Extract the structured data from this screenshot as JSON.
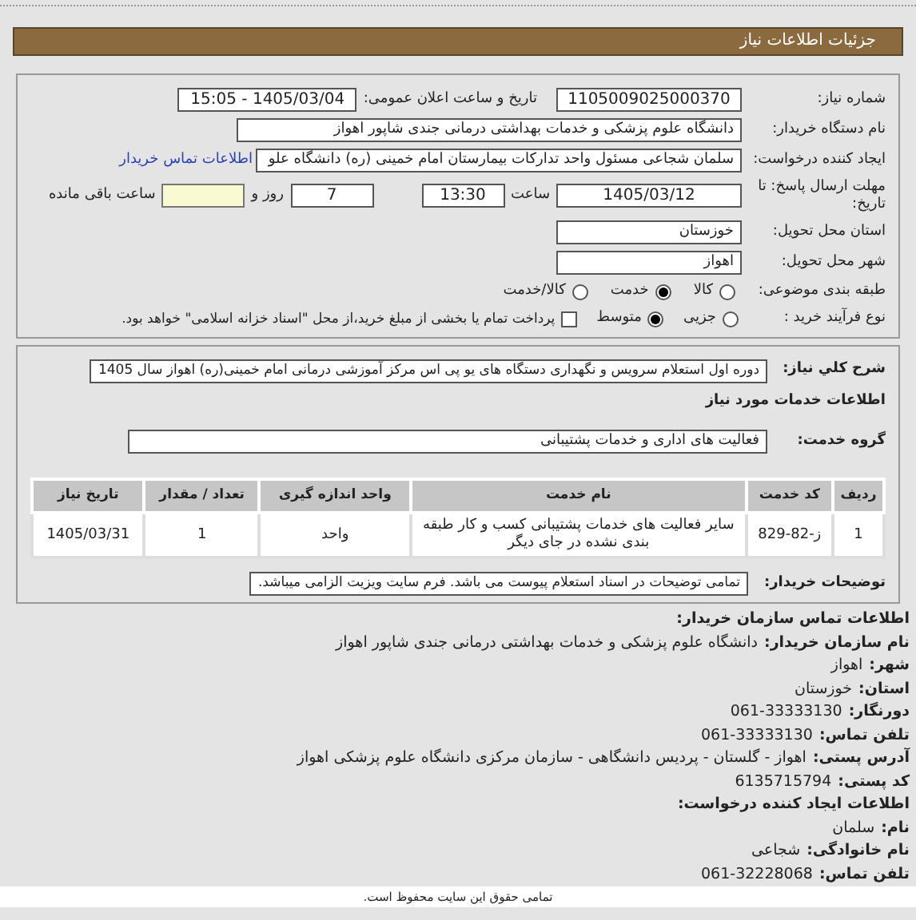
{
  "header": {
    "title": "جزئیات اطلاعات نیاز"
  },
  "need_number": {
    "label": "شماره نیاز:",
    "value": "1105009025000370"
  },
  "announce": {
    "label": "تاریخ و ساعت اعلان عمومی:",
    "value": "1405/03/04 - 15:05"
  },
  "buyer_name": {
    "label": "نام دستگاه خریدار:",
    "value": "دانشگاه علوم پزشکی و خدمات بهداشتی درمانی جندی شاپور اهواز"
  },
  "requester": {
    "label": "ایجاد کننده درخواست:",
    "value": "سلمان شجاعی مسئول واحد تدارکات بیمارستان امام خمینی (ره) دانشگاه علو",
    "link": "اطلاعات تماس خریدار"
  },
  "deadline": {
    "label": "مهلت ارسال پاسخ: تا تاریخ:",
    "date": "1405/03/12",
    "time_label": "ساعت",
    "time": "13:30",
    "days": "7",
    "days_label": "روز و",
    "remaining_label": "ساعت باقی مانده"
  },
  "province": {
    "label": "استان محل تحویل:",
    "value": "خوزستان"
  },
  "city": {
    "label": "شهر محل تحویل:",
    "value": "اهواز"
  },
  "category": {
    "label": "طبقه بندی موضوعی:",
    "options": [
      {
        "label": "کالا",
        "selected": false
      },
      {
        "label": "خدمت",
        "selected": true
      },
      {
        "label": "کالا/خدمت",
        "selected": false
      }
    ]
  },
  "purchase_type": {
    "label": "نوع فرآیند خرید :",
    "options": [
      {
        "label": "جزیی",
        "selected": false
      },
      {
        "label": "متوسط",
        "selected": true
      }
    ],
    "checkbox": {
      "label": "پرداخت تمام یا بخشی از مبلغ خرید،از محل \"اسناد خزانه اسلامی\" خواهد بود.",
      "checked": false
    }
  },
  "description": {
    "label": "شرح کلي نياز:",
    "value": "دوره اول استعلام سرویس و نگهداری دستگاه های یو پی اس مرکز آموزشی درمانی امام خمینی(ره) اهواز سال 1405"
  },
  "services_title": "اطلاعات خدمات مورد نیاز",
  "service_group": {
    "label": "گروه خدمت:",
    "value": "فعالیت های اداری و خدمات پشتیبانی"
  },
  "table": {
    "columns": [
      "ردیف",
      "کد خدمت",
      "نام خدمت",
      "واحد اندازه گیری",
      "تعداد / مقدار",
      "تاریخ نیاز"
    ],
    "rows": [
      [
        "1",
        "ز-82-829",
        "سایر فعالیت های خدمات پشتیبانی کسب و کار طبقه بندی نشده در جای دیگر",
        "واحد",
        "1",
        "1405/03/31"
      ]
    ]
  },
  "buyer_notes": {
    "label": "توضیحات خریدار:",
    "value": "تمامی توضیحات در اسناد استعلام پیوست می باشد. فرم سایت ویزیت الزامی میباشد."
  },
  "contact": [
    {
      "kind": "heading",
      "label": "اطلاعات تماس سازمان خریدار:"
    },
    {
      "kind": "line",
      "label": "نام سازمان خریدار:",
      "value": "دانشگاه علوم پزشکی و خدمات بهداشتی درمانی جندی شاپور اهواز"
    },
    {
      "kind": "line",
      "label": "شهر:",
      "value": "اهواز"
    },
    {
      "kind": "line",
      "label": "استان:",
      "value": "خوزستان"
    },
    {
      "kind": "line",
      "label": "دورنگار:",
      "value": "061-33333130"
    },
    {
      "kind": "line",
      "label": "تلفن تماس:",
      "value": "061-33333130"
    },
    {
      "kind": "line",
      "label": "آدرس پستی:",
      "value": "اهواز - گلستان - پردیس دانشگاهی - سازمان مرکزی دانشگاه علوم پزشکی اهواز"
    },
    {
      "kind": "line",
      "label": "کد پستی:",
      "value": "6135715794"
    },
    {
      "kind": "heading",
      "label": "اطلاعات ایجاد کننده درخواست:"
    },
    {
      "kind": "line",
      "label": "نام:",
      "value": "سلمان"
    },
    {
      "kind": "line",
      "label": "نام خانوادگی:",
      "value": "شجاعی"
    },
    {
      "kind": "line",
      "label": "تلفن تماس:",
      "value": "061-32228068"
    }
  ],
  "footer": "تمامی حقوق این سایت محفوظ است."
}
